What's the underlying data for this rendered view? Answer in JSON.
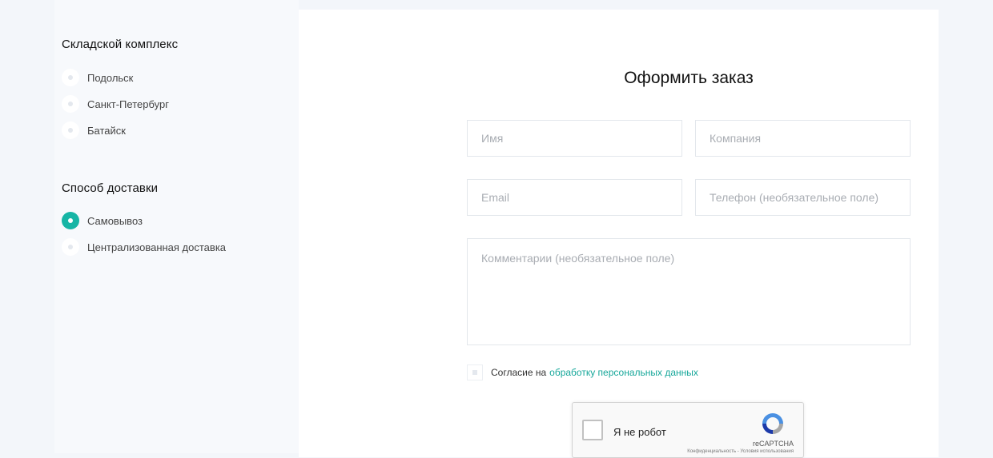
{
  "warehouse": {
    "title": "Складской комплекс",
    "options": [
      {
        "label": "Подольск",
        "checked": false
      },
      {
        "label": "Санкт-Петербург",
        "checked": false
      },
      {
        "label": "Батайск",
        "checked": false
      }
    ]
  },
  "delivery": {
    "title": "Способ доставки",
    "options": [
      {
        "label": "Самовывоз",
        "checked": true
      },
      {
        "label": "Централизованная доставка",
        "checked": false
      }
    ]
  },
  "form": {
    "title": "Оформить заказ",
    "name_placeholder": "Имя",
    "company_placeholder": "Компания",
    "email_placeholder": "Email",
    "phone_placeholder": "Телефон (необязательное поле)",
    "comment_placeholder": "Комментарии (необязательное поле)",
    "consent_text": "Согласие на",
    "consent_link": "обработку персональных данных"
  },
  "captcha": {
    "label": "Я не робот",
    "brand": "reCAPTCHA",
    "terms": "Конфиденциальность - Условия использования"
  },
  "colors": {
    "accent": "#16b5a5",
    "link": "#16a79a",
    "background": "#f3f6fa"
  }
}
